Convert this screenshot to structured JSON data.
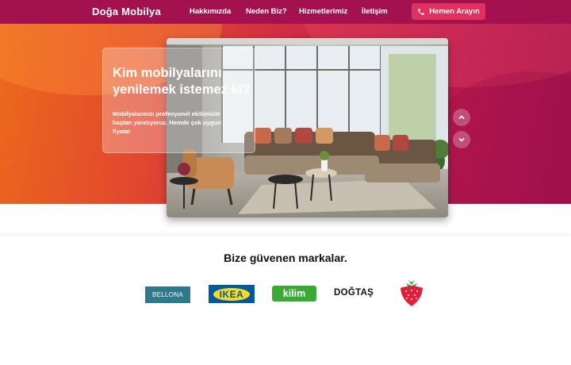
{
  "navbar": {
    "brand": "Doğa Mobilya",
    "links": [
      "Hakkımızda",
      "Neden Biz?",
      "Hizmetlerimiz",
      "İletişim"
    ],
    "call_button": "Hemen Arayın"
  },
  "hero": {
    "title": "Kim mobilyalarını yenilemek istemez ki?",
    "text": "Mobilyalarınızı profesyonel ekibimizle baştan yaratıyoruz. Hemde çok uygun fiyata!"
  },
  "brands": {
    "title": "Bize güvenen markalar.",
    "logos": [
      "BELLONA",
      "IKEA",
      "kilim",
      "DOĞTAŞ"
    ]
  },
  "colors": {
    "navbar": "#a3124f",
    "button": "#e0325f",
    "hero_start": "#ec6a1b",
    "hero_end": "#a3124f"
  }
}
